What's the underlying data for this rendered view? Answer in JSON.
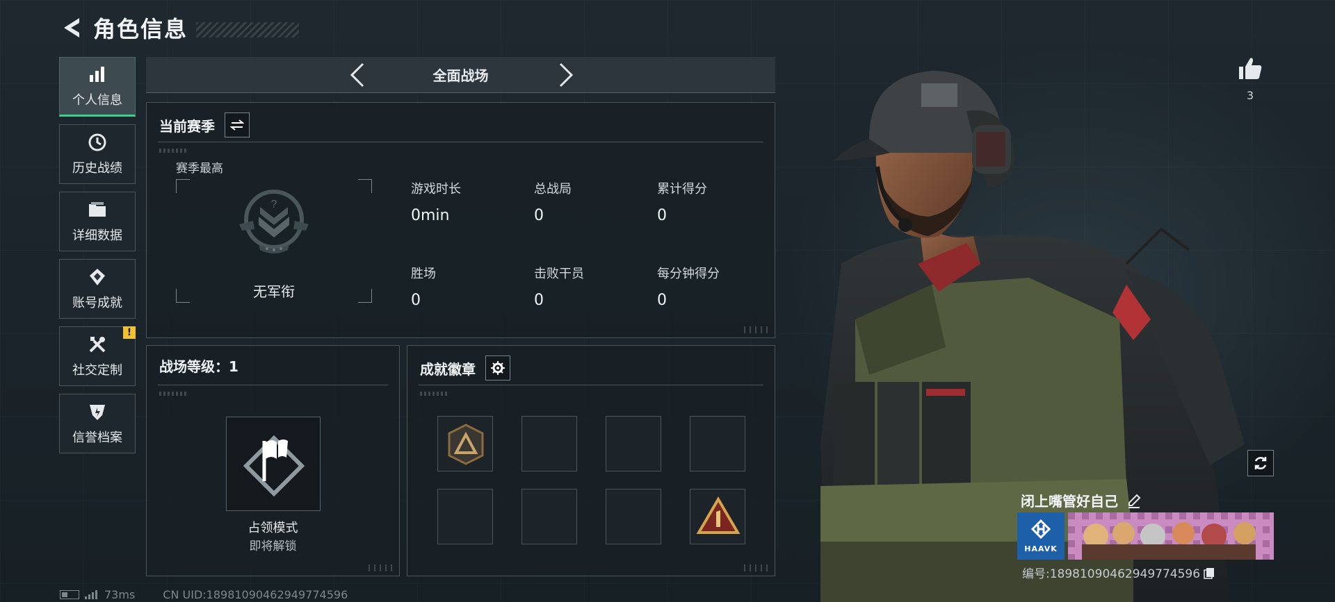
{
  "header": {
    "title": "角色信息"
  },
  "sidebar": {
    "items": [
      {
        "label": "个人信息",
        "icon": "bar-chart-icon",
        "active": true
      },
      {
        "label": "历史战绩",
        "icon": "history-icon"
      },
      {
        "label": "详细数据",
        "icon": "folder-icon"
      },
      {
        "label": "账号成就",
        "icon": "achievement-icon"
      },
      {
        "label": "社交定制",
        "icon": "tools-icon",
        "alert": "!"
      },
      {
        "label": "信誉档案",
        "icon": "shield-icon"
      }
    ]
  },
  "mode": {
    "title": "全面战场"
  },
  "season": {
    "title": "当前赛季",
    "best_label": "赛季最高",
    "rank_name": "无军衔",
    "stats": [
      {
        "label": "游戏时长",
        "value": "0min"
      },
      {
        "label": "总战局",
        "value": "0"
      },
      {
        "label": "累计得分",
        "value": "0"
      },
      {
        "label": "胜场",
        "value": "0"
      },
      {
        "label": "击败干员",
        "value": "0"
      },
      {
        "label": "每分钟得分",
        "value": "0"
      }
    ]
  },
  "level": {
    "title": "战场等级：1",
    "mode_name": "占领模式",
    "mode_status": "即将解锁"
  },
  "badges": {
    "title": "成就徽章"
  },
  "likes": {
    "count": "3"
  },
  "player": {
    "name": "闭上嘴管好自己",
    "clan_logo_text": "HAAVK",
    "id_text": "编号:18981090462949774596"
  },
  "status": {
    "ping": "73ms",
    "uid": "CN UID:18981090462949774596"
  },
  "colors": {
    "accent": "#34d58a",
    "alert": "#f2c230",
    "bg": "#1a2329"
  }
}
